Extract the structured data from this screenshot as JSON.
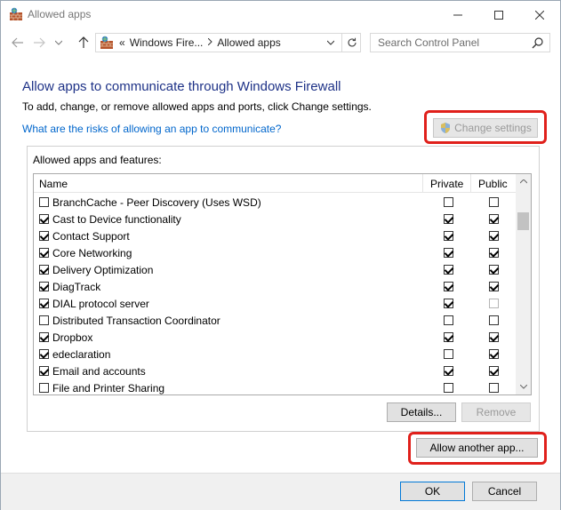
{
  "window": {
    "title": "Allowed apps"
  },
  "address": {
    "overflow": "«",
    "breadcrumbs": [
      "Windows Fire...",
      "Allowed apps"
    ],
    "search_placeholder": "Search Control Panel"
  },
  "content": {
    "heading": "Allow apps to communicate through Windows Firewall",
    "subtext": "To add, change, or remove allowed apps and ports, click Change settings.",
    "risk_link": "What are the risks of allowing an app to communicate?",
    "change_settings_label": "Change settings",
    "group_label": "Allowed apps and features:",
    "columns": {
      "name": "Name",
      "private": "Private",
      "public": "Public"
    },
    "rows": [
      {
        "name": "BranchCache - Peer Discovery (Uses WSD)",
        "enabled": false,
        "private": false,
        "public": false,
        "public_disabled": false
      },
      {
        "name": "Cast to Device functionality",
        "enabled": true,
        "private": true,
        "public": true,
        "public_disabled": false
      },
      {
        "name": "Contact Support",
        "enabled": true,
        "private": true,
        "public": true,
        "public_disabled": false
      },
      {
        "name": "Core Networking",
        "enabled": true,
        "private": true,
        "public": true,
        "public_disabled": false
      },
      {
        "name": "Delivery Optimization",
        "enabled": true,
        "private": true,
        "public": true,
        "public_disabled": false
      },
      {
        "name": "DiagTrack",
        "enabled": true,
        "private": true,
        "public": true,
        "public_disabled": false
      },
      {
        "name": "DIAL protocol server",
        "enabled": true,
        "private": true,
        "public": false,
        "public_disabled": true
      },
      {
        "name": "Distributed Transaction Coordinator",
        "enabled": false,
        "private": false,
        "public": false,
        "public_disabled": false
      },
      {
        "name": "Dropbox",
        "enabled": true,
        "private": true,
        "public": true,
        "public_disabled": false
      },
      {
        "name": "edeclaration",
        "enabled": true,
        "private": false,
        "public": true,
        "public_disabled": false
      },
      {
        "name": "Email and accounts",
        "enabled": true,
        "private": true,
        "public": true,
        "public_disabled": false
      },
      {
        "name": "File and Printer Sharing",
        "enabled": false,
        "private": false,
        "public": false,
        "public_disabled": false
      }
    ],
    "details_label": "Details...",
    "remove_label": "Remove",
    "allow_another_label": "Allow another app..."
  },
  "footer": {
    "ok_label": "OK",
    "cancel_label": "Cancel"
  },
  "colors": {
    "heading": "#1e3287",
    "link": "#0066cc",
    "highlight": "#e0201b"
  }
}
